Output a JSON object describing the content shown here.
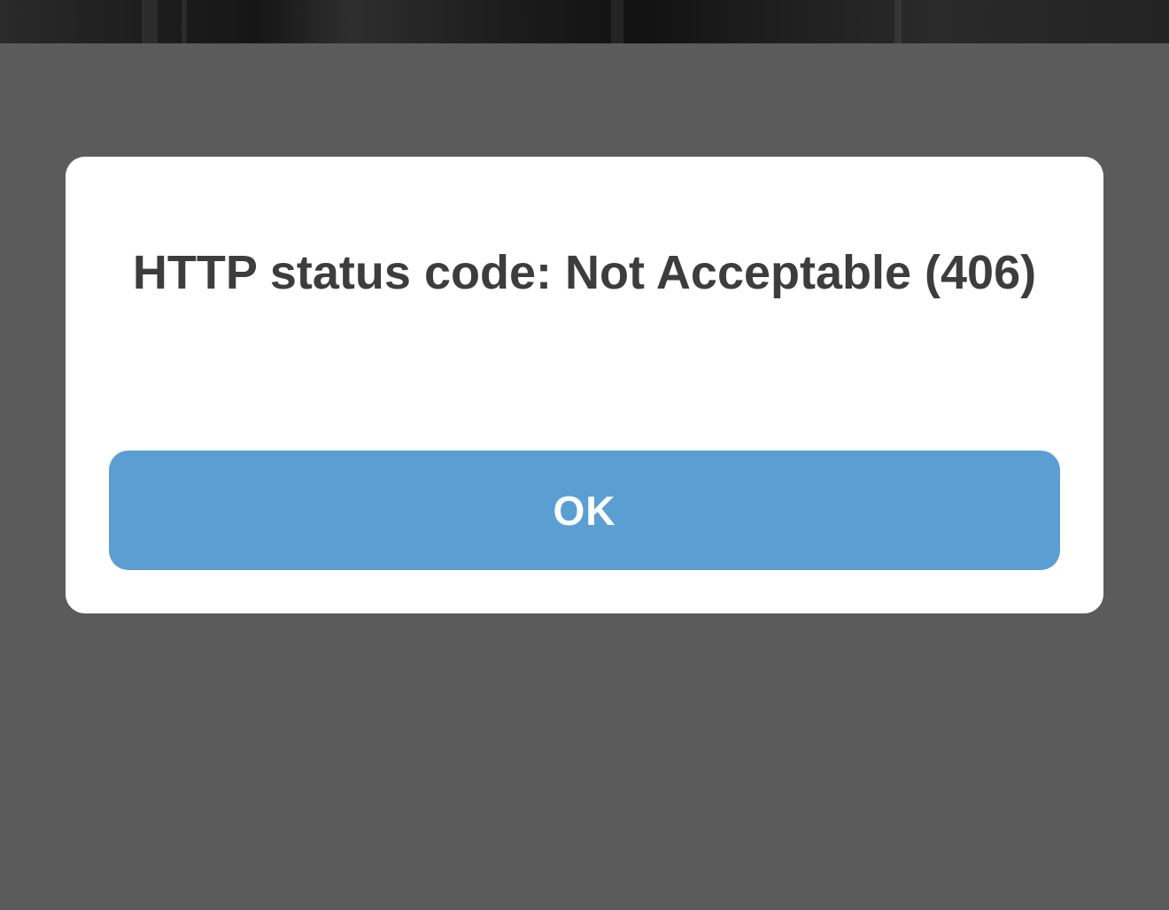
{
  "alert": {
    "message": "HTTP status code: Not Acceptable (406)",
    "ok_label": "OK"
  },
  "colors": {
    "backdrop": "#5b5b5b",
    "dialog_background": "#ffffff",
    "message_text": "#3d3d3d",
    "button_background": "#5b9fd2",
    "button_text": "#ffffff"
  }
}
